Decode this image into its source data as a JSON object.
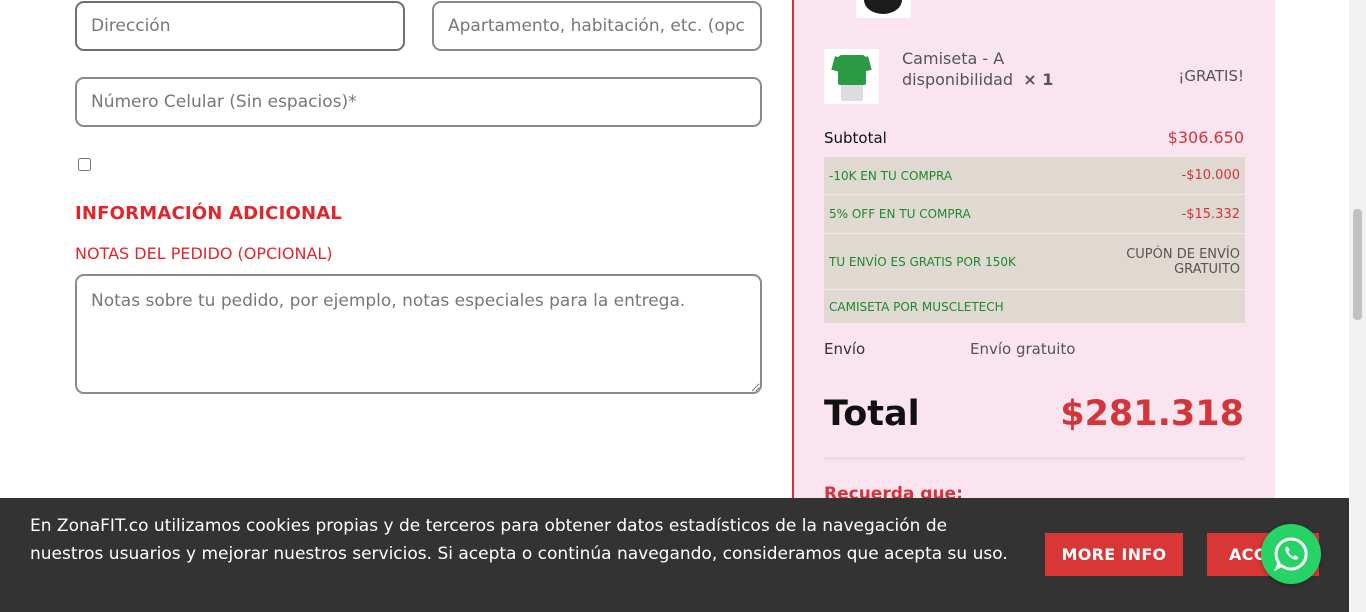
{
  "form": {
    "address_placeholder": "Dirección",
    "apartment_placeholder": "Apartamento, habitación, etc. (opcional)",
    "phone_placeholder": "Número Celular (Sin espacios)*",
    "additional_info_title": "INFORMACIÓN ADICIONAL",
    "order_notes_label": "NOTAS DEL PEDIDO (OPCIONAL)",
    "order_notes_placeholder": "Notas sobre tu pedido, por ejemplo, notas especiales para la entrega."
  },
  "summary": {
    "product": {
      "name_line1": "Camiseta - A",
      "name_line2": "disponibilidad",
      "quantity": "× 1",
      "price": "¡GRATIS!"
    },
    "subtotal_label": "Subtotal",
    "subtotal_value": "$306.650",
    "coupons": [
      {
        "label": "-10K EN TU COMPRA",
        "value": "-$10.000"
      },
      {
        "label": "5% OFF EN TU COMPRA",
        "value": "-$15.332"
      },
      {
        "label": "TU ENVÍO ES GRATIS POR 150K",
        "value": "CUPÓN DE ENVÍO GRATUITO"
      },
      {
        "label": "CAMISETA POR MUSCLETECH",
        "value": ""
      }
    ],
    "shipping_label": "Envío",
    "shipping_value": "Envío gratuito",
    "total_label": "Total",
    "total_value": "$281.318",
    "reminder_heading": "Recuerda que:"
  },
  "cookie_bar": {
    "text": "En ZonaFIT.co utilizamos cookies propias y de terceros para obtener datos estadísticos de la navegación de nuestros usuarios y mejorar nuestros servicios. Si acepta o continúa navegando, consideramos que acepta su uso.",
    "more_info_label": "MORE INFO",
    "accept_label": "ACCEPT"
  },
  "colors": {
    "accent_red": "#d2353a",
    "summary_bg": "#f9e4ef",
    "coupon_green": "#1d8a2a",
    "whatsapp_green": "#25d366"
  }
}
